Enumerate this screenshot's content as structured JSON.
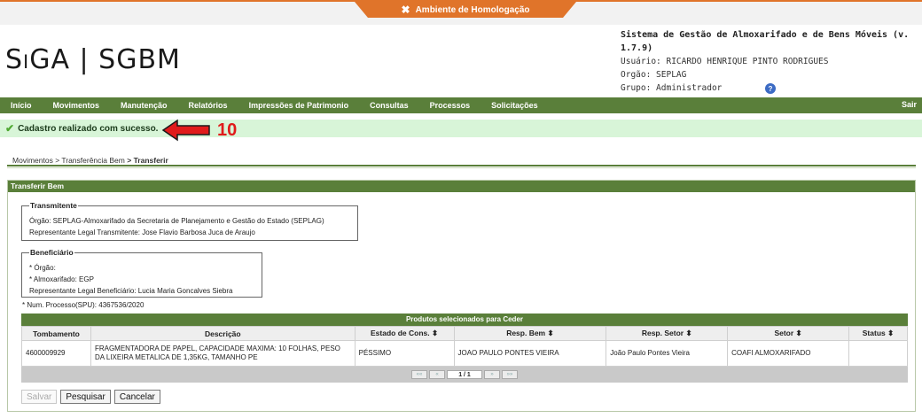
{
  "env": {
    "label": "Ambiente de Homologação",
    "icon": "tools-icon"
  },
  "header": {
    "logo": "SiGA | SGBM",
    "system_title": "Sistema de Gestão de Almoxarifado e de Bens Móveis (v. 1.7.9)",
    "user_line": "Usuário: RICARDO HENRIQUE PINTO RODRIGUES",
    "org_line": "Orgão: SEPLAG",
    "group_line": "Grupo: Administrador",
    "help": "?"
  },
  "menu": {
    "items": [
      "Início",
      "Movimentos",
      "Manutenção",
      "Relatórios",
      "Impressões de Patrimonio",
      "Consultas",
      "Processos",
      "Solicitações"
    ],
    "logout": "Sair"
  },
  "message": {
    "text": "Cadastro realizado com sucesso.",
    "annotation": "10",
    "color": "#e01b1b"
  },
  "breadcrumb": {
    "a": "Movimentos",
    "b": "> Transferência Bem",
    "c": "> Transferir"
  },
  "panel": {
    "title": "Transferir Bem",
    "transmitente": {
      "legend": "Transmitente",
      "orgao": "Órgão: SEPLAG-Almoxarifado da Secretaria de Planejamento e Gestão do Estado (SEPLAG)",
      "rep": "Representante Legal Transmitente: Jose Flavio Barbosa Juca de Araujo"
    },
    "beneficiario": {
      "legend": "Beneficiário",
      "orgao": "* Órgão:",
      "almox": "* Almoxarifado: EGP",
      "rep": "Representante Legal Beneficiário: Lucia Maria Goncalves Siebra"
    },
    "num_processo": "* Num. Processo(SPU): 4367536/2020"
  },
  "table": {
    "caption": "Produtos selecionados para Ceder",
    "columns": [
      "Tombamento",
      "Descrição",
      "Estado de Cons. ⬍",
      "Resp. Bem ⬍",
      "Resp. Setor ⬍",
      "Setor ⬍",
      "Status ⬍"
    ],
    "rows": [
      {
        "tombamento": "4600009929",
        "descricao": "FRAGMENTADORA DE PAPEL, CAPACIDADE MAXIMA: 10 FOLHAS, PESO DA LIXEIRA METALICA DE 1,35KG, TAMANHO PE",
        "estado": "PÉSSIMO",
        "resp_bem": "JOAO PAULO PONTES VIEIRA",
        "resp_setor": "João Paulo Pontes Vieira",
        "setor": "COAFI ALMOXARIFADO",
        "status": ""
      }
    ],
    "pager": {
      "first": "««",
      "prev": "«",
      "info": "1 / 1",
      "next": "»",
      "last": "»»"
    }
  },
  "buttons": {
    "save": "Salvar",
    "search": "Pesquisar",
    "cancel": "Cancelar"
  }
}
